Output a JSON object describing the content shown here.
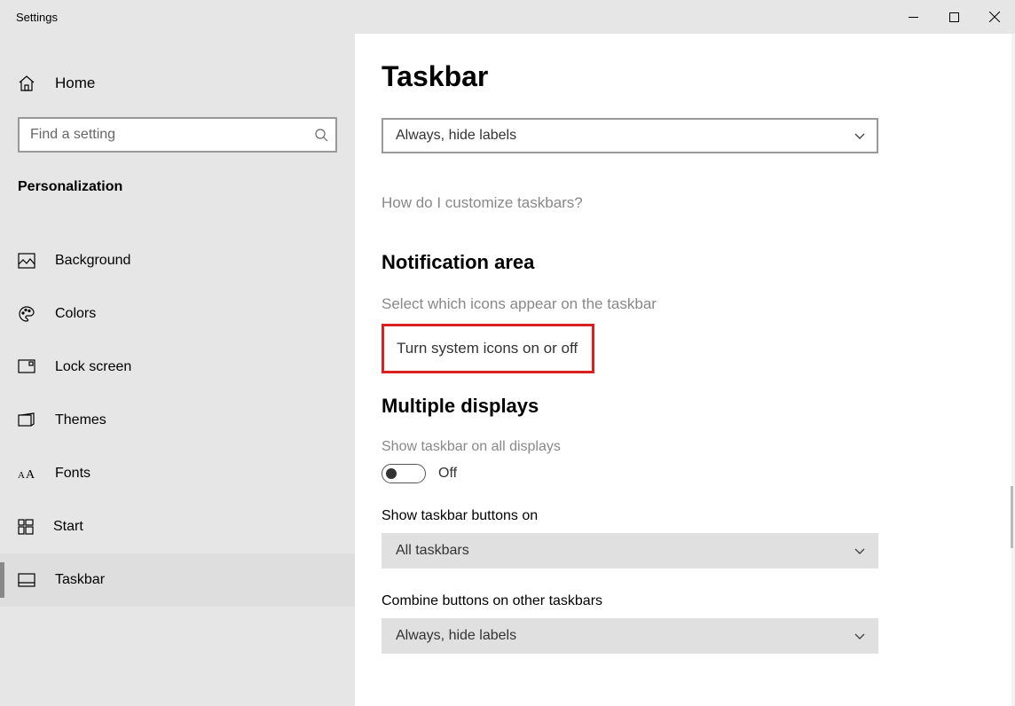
{
  "window": {
    "title": "Settings"
  },
  "sidebar": {
    "home": "Home",
    "search_placeholder": "Find a setting",
    "category": "Personalization",
    "items": [
      {
        "label": "Background",
        "icon": "image-icon"
      },
      {
        "label": "Colors",
        "icon": "palette-icon"
      },
      {
        "label": "Lock screen",
        "icon": "lockscreen-icon"
      },
      {
        "label": "Themes",
        "icon": "themes-icon"
      },
      {
        "label": "Fonts",
        "icon": "fonts-icon"
      },
      {
        "label": "Start",
        "icon": "start-icon"
      },
      {
        "label": "Taskbar",
        "icon": "taskbar-icon",
        "active": true
      }
    ]
  },
  "content": {
    "title": "Taskbar",
    "dropdown1": "Always, hide labels",
    "help_link": "How do I customize taskbars?",
    "section_notification": "Notification area",
    "link_select_icons": "Select which icons appear on the taskbar",
    "link_system_icons": "Turn system icons on or off",
    "section_multiple": "Multiple displays",
    "show_all_label": "Show taskbar on all displays",
    "toggle_state": "Off",
    "show_buttons_label": "Show taskbar buttons on",
    "dropdown2": "All taskbars",
    "combine_label": "Combine buttons on other taskbars",
    "dropdown3": "Always, hide labels"
  }
}
